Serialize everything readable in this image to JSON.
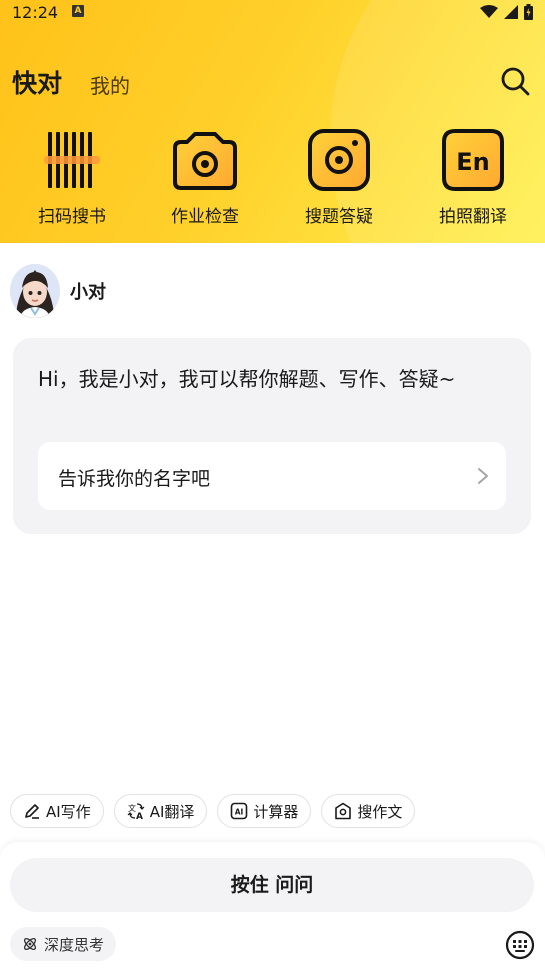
{
  "status_bar": {
    "time": "12:24",
    "indicator": "A"
  },
  "nav": {
    "title": "快对",
    "mine": "我的"
  },
  "quick_actions": [
    {
      "label": "扫码搜书",
      "icon": "barcode-icon"
    },
    {
      "label": "作业检查",
      "icon": "camera-icon"
    },
    {
      "label": "搜题答疑",
      "icon": "camera-square-icon"
    },
    {
      "label": "拍照翻译",
      "icon": "translate-en-icon"
    }
  ],
  "bot": {
    "name": "小对"
  },
  "message": {
    "text": "Hi，我是小对，我可以帮你解题、写作、答疑~",
    "suggestion": "告诉我你的名字吧"
  },
  "chips": [
    {
      "label": "AI写作",
      "icon": "pen-icon"
    },
    {
      "label": "AI翻译",
      "icon": "translate-icon"
    },
    {
      "label": "计算器",
      "icon": "ai-calculator-icon"
    },
    {
      "label": "搜作文",
      "icon": "search-essay-icon"
    }
  ],
  "input": {
    "press_label": "按住 问问",
    "deep_think": "深度思考"
  },
  "colors": {
    "header_start": "#ffc21a",
    "header_end": "#fff04f",
    "icon_gradient": "#ffb52a"
  }
}
